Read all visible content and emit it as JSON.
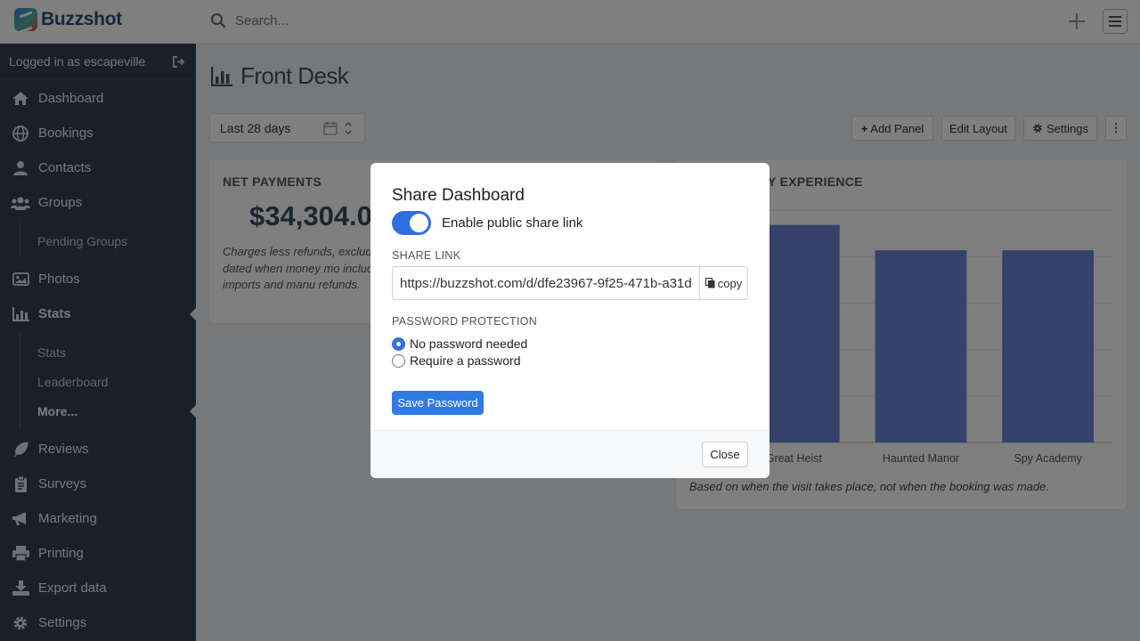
{
  "app": {
    "name": "Buzzshot"
  },
  "search": {
    "placeholder": "Search..."
  },
  "sidebar": {
    "logged_in": "Logged in as escapeville",
    "items": [
      {
        "label": "Dashboard"
      },
      {
        "label": "Bookings"
      },
      {
        "label": "Contacts"
      },
      {
        "label": "Groups"
      },
      {
        "label": "Pending Groups"
      },
      {
        "label": "Photos"
      },
      {
        "label": "Stats"
      },
      {
        "label": "Stats"
      },
      {
        "label": "Leaderboard"
      },
      {
        "label": "More..."
      },
      {
        "label": "Reviews"
      },
      {
        "label": "Surveys"
      },
      {
        "label": "Marketing"
      },
      {
        "label": "Printing"
      },
      {
        "label": "Export data"
      },
      {
        "label": "Settings"
      }
    ]
  },
  "main": {
    "title": "Front Desk",
    "date_range": "Last 28 days",
    "toolbar": {
      "add_panel": "Add Panel",
      "edit_layout": "Edit Layout",
      "settings": "Settings"
    },
    "net_payments": {
      "title": "NET PAYMENTS",
      "value": "$34,304.0",
      "description": "Charges less refunds, excludi cards; dated when money mo including imports and manu refunds."
    },
    "experience_card": {
      "title_visible": "Y EXPERIENCE",
      "caption": "Based on when the visit takes place, not when the booking was made."
    }
  },
  "chart_data": {
    "type": "bar",
    "categories": [
      "Great Heist",
      "Haunted Manor",
      "Spy Academy"
    ],
    "values": [
      5.15,
      4.55,
      4.55
    ],
    "ylim": [
      0,
      5.5
    ],
    "grid": true,
    "bar_color": "#6b86d4"
  },
  "modal": {
    "title": "Share Dashboard",
    "toggle_label": "Enable public share link",
    "toggle_on": true,
    "share_link_label": "SHARE LINK",
    "share_link_value": "https://buzzshot.com/d/dfe23967-9f25-471b-a31d-",
    "copy_label": "copy",
    "password_label": "PASSWORD PROTECTION",
    "option_none": "No password needed",
    "option_require": "Require a password",
    "save_label": "Save Password",
    "close_label": "Close"
  },
  "colors": {
    "accent": "#2f6fe4",
    "sidebar_bg": "#354152",
    "brand_text": "#2a4e78"
  }
}
